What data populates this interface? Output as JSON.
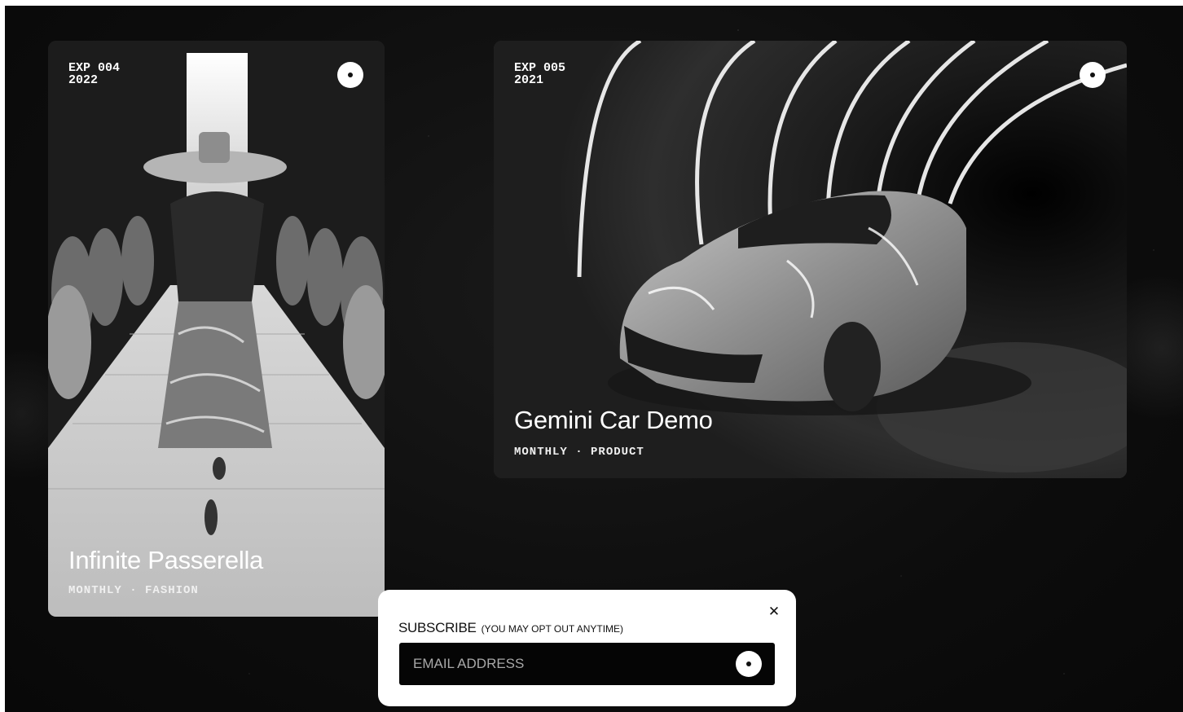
{
  "cards": [
    {
      "exp": "EXP 004",
      "year": "2022",
      "title": "Infinite Passerella",
      "meta": "MONTHLY · FASHION",
      "image": "runway-fashion-model-art"
    },
    {
      "exp": "EXP 005",
      "year": "2021",
      "title": "Gemini Car Demo",
      "meta": "MONTHLY · PRODUCT",
      "image": "sports-car-light-tunnel-art"
    }
  ],
  "subscribe": {
    "heading": "SUBSCRIBE",
    "note": "(YOU MAY OPT OUT ANYTIME)",
    "email_placeholder": "EMAIL ADDRESS",
    "close_icon": "close-icon",
    "submit_icon": "dot-icon"
  },
  "colors": {
    "background": "#0d0d0d",
    "card_text": "#ffffff",
    "popup_bg": "#ffffff",
    "input_bg": "#050505"
  }
}
